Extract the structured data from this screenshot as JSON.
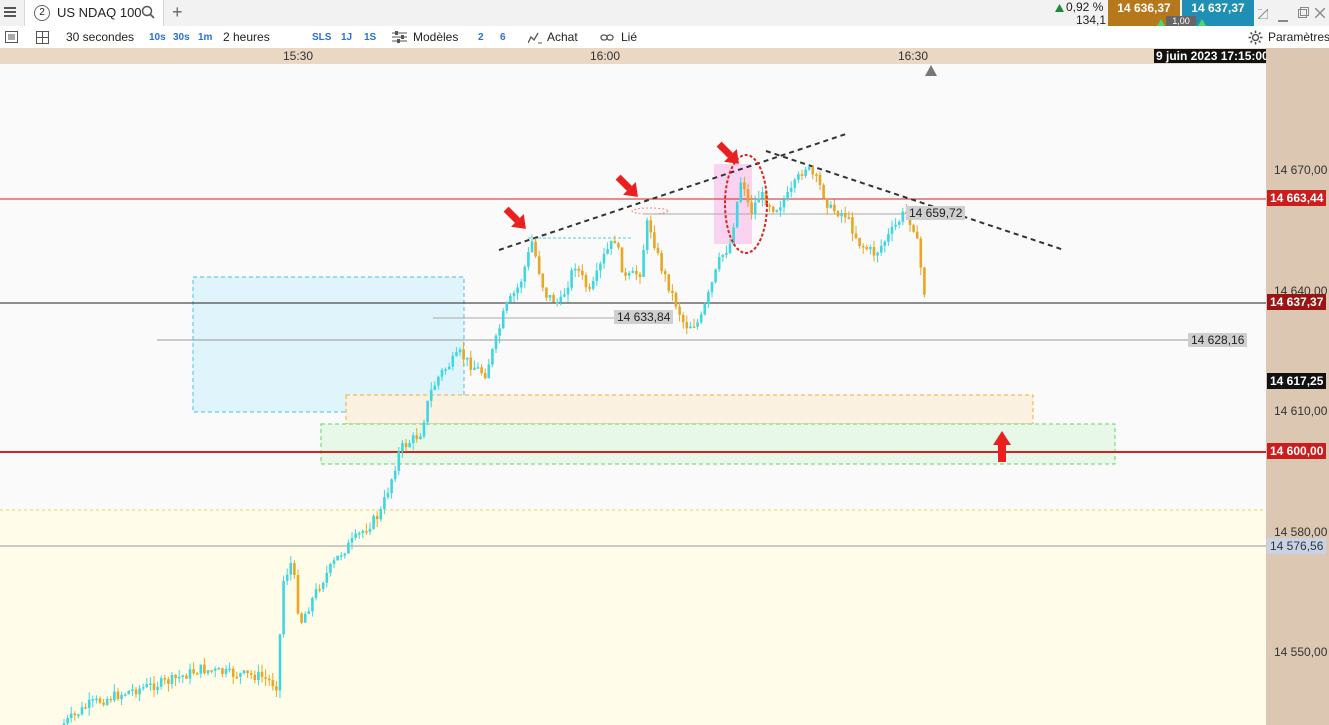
{
  "tab": {
    "number": "2",
    "instrument": "US NDAQ 100",
    "add": "+"
  },
  "market": {
    "change_pct": "0,92 %",
    "change_pts": "134,1",
    "bid": "14 636,37",
    "ask": "14 637,37",
    "spread": "1,00",
    "bid_color": "#b5781b",
    "ask_color": "#1f8fb5"
  },
  "toolbar": {
    "interval": "30 secondes",
    "quick_10s": "10s",
    "quick_30s": "30s",
    "quick_1m": "1m",
    "duration": "2 heures",
    "sls": "SLS",
    "d1": "1J",
    "s1": "1S",
    "models": "Modèles",
    "n2": "2",
    "n6": "6",
    "buy": "Achat",
    "linked": "Lié",
    "settings": "Paramètres"
  },
  "time_axis": {
    "labels": [
      "15:30",
      "16:00",
      "16:30"
    ],
    "date": "9 juin 2023 17:15:00"
  },
  "price_axis": {
    "labels": [
      "14 670,00",
      "14 640,00",
      "14 610,00",
      "14 580,00",
      "14 550,00"
    ],
    "tags": {
      "resistance": "14 663,44",
      "current": "14 637,37",
      "dark": "14 617,25",
      "support": "14 600,00",
      "lower": "14 576,56"
    }
  },
  "chart_tags": {
    "t1": "14 659,72",
    "t2": "14 633,84",
    "t3": "14 628,16"
  },
  "colors": {
    "up": "#3fd6e0",
    "down": "#e8a623",
    "resistance": "#d32020",
    "accent_red": "#e82020"
  },
  "icons": {
    "menu": "menu-icon",
    "search": "search-icon",
    "list": "list-icon",
    "grid": "layout-grid-icon",
    "models": "models-icon",
    "buy": "buy-pen-icon",
    "link": "link-icon",
    "settings": "gear-icon"
  }
}
